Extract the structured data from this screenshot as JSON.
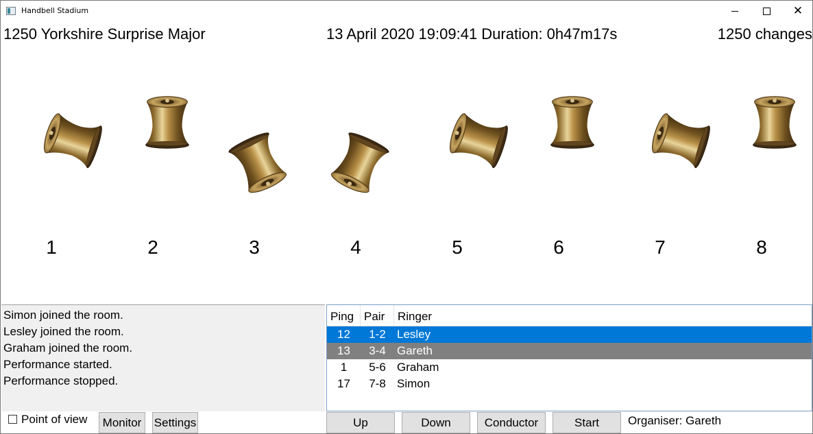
{
  "window": {
    "title": "Handbell Stadium",
    "app_icon": "app-window-icon"
  },
  "header": {
    "method": "1250 Yorkshire Surprise Major",
    "datetime": "13 April 2020  19:09:41 Duration: 0h47m17s",
    "changes": "1250 changes"
  },
  "bells": [
    {
      "number": "1",
      "state": "handstroke-left"
    },
    {
      "number": "2",
      "state": "up"
    },
    {
      "number": "3",
      "state": "down-right"
    },
    {
      "number": "4",
      "state": "down-left"
    },
    {
      "number": "5",
      "state": "handstroke-left"
    },
    {
      "number": "6",
      "state": "up"
    },
    {
      "number": "7",
      "state": "handstroke-left"
    },
    {
      "number": "8",
      "state": "up"
    }
  ],
  "log": {
    "lines": [
      "Simon joined the room.",
      "Lesley joined the room.",
      "Graham joined the room.",
      "Performance started.",
      "Performance stopped."
    ]
  },
  "ringers": {
    "columns": [
      "Ping",
      "Pair",
      "Ringer"
    ],
    "rows": [
      {
        "ping": "12",
        "pair": "1-2",
        "ringer": "Lesley",
        "style": "selected"
      },
      {
        "ping": "13",
        "pair": "3-4",
        "ringer": "Gareth",
        "style": "inactive"
      },
      {
        "ping": "1",
        "pair": "5-6",
        "ringer": "Graham",
        "style": "normal"
      },
      {
        "ping": "17",
        "pair": "7-8",
        "ringer": "Simon",
        "style": "normal"
      }
    ]
  },
  "controls": {
    "point_of_view_label": "Point of view",
    "point_of_view_checked": false,
    "monitor_label": "Monitor",
    "settings_label": "Settings",
    "up_label": "Up",
    "down_label": "Down",
    "conductor_label": "Conductor",
    "start_label": "Start",
    "organiser": "Organiser: Gareth"
  },
  "colors": {
    "selection": "#0078d7",
    "inactive_row": "#808080",
    "log_bg": "#f0f0f0",
    "button_bg": "#e1e1e1"
  }
}
